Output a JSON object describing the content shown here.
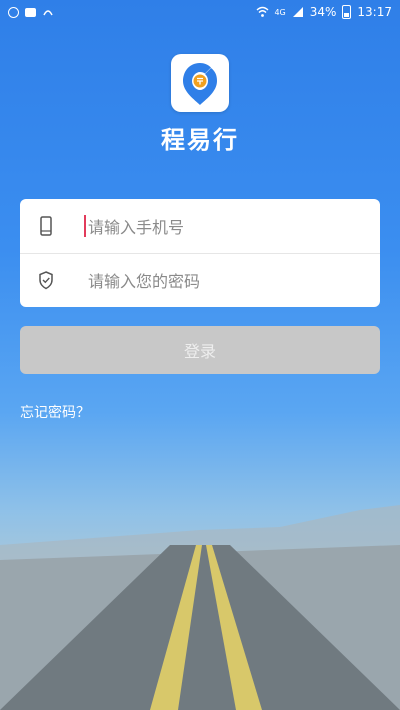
{
  "status_bar": {
    "network": "4G",
    "battery": "34%",
    "time": "13:17"
  },
  "app": {
    "name": "程易行",
    "logo_icon": "location-pin-c-icon",
    "accent": "#2f7fe8",
    "logo_orange": "#f0a020"
  },
  "login_form": {
    "phone_placeholder": "请输入手机号",
    "password_placeholder": "请输入您的密码",
    "phone_icon": "phone-icon",
    "password_icon": "shield-icon"
  },
  "login_button": {
    "label": "登录"
  },
  "forgot_link": {
    "label": "忘记密码？"
  }
}
